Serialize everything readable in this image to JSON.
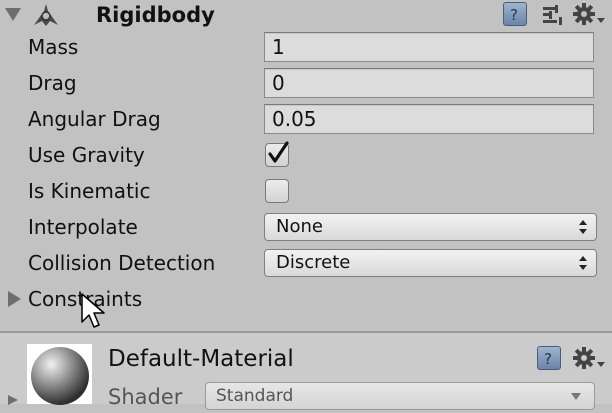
{
  "component": {
    "title": "Rigidbody",
    "expanded": true,
    "icons": [
      "help-book-icon",
      "preset-sliders-icon",
      "gear-dropdown-icon"
    ]
  },
  "fields": {
    "mass": {
      "label": "Mass",
      "value": "1"
    },
    "drag": {
      "label": "Drag",
      "value": "0"
    },
    "angular_drag": {
      "label": "Angular Drag",
      "value": "0.05"
    },
    "use_gravity": {
      "label": "Use Gravity",
      "checked": true
    },
    "is_kinematic": {
      "label": "Is Kinematic",
      "checked": false
    },
    "interpolate": {
      "label": "Interpolate",
      "selected": "None"
    },
    "collision_detection": {
      "label": "Collision Detection",
      "selected": "Discrete"
    },
    "constraints": {
      "label": "Constraints",
      "expanded": false
    }
  },
  "material": {
    "name": "Default-Material",
    "shader_label": "Shader",
    "shader_value": "Standard"
  },
  "colors": {
    "panel": "#c2c2c2",
    "field": "#dcdcdc",
    "icon_blue": "#7f96b9"
  }
}
